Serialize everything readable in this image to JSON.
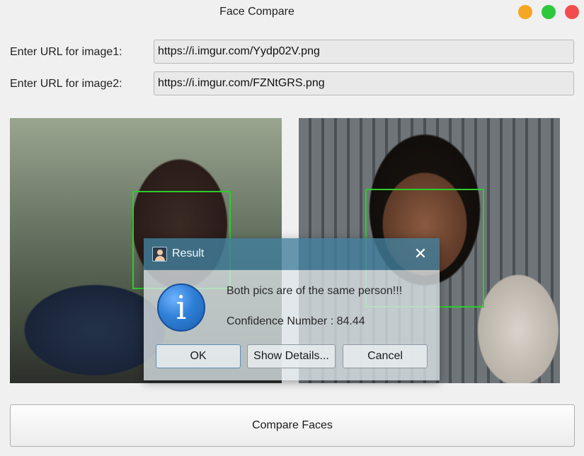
{
  "window": {
    "title": "Face Compare",
    "controls": {
      "minimize_color": "#f5a623",
      "maximize_color": "#2dc83c",
      "close_color": "#f24c4c"
    }
  },
  "form": {
    "image1_label": "Enter URL for image1:",
    "image1_value": "https://i.imgur.com/Yydp02V.png",
    "image2_label": "Enter URL for image2:",
    "image2_value": "https://i.imgur.com/FZNtGRS.png"
  },
  "images": [
    {
      "name": "image1-preview",
      "face_box_color": "#2ecc2e"
    },
    {
      "name": "image2-preview",
      "face_box_color": "#2ecc2e"
    }
  ],
  "compare_button": {
    "label": "Compare Faces"
  },
  "dialog": {
    "title": "Result",
    "close_glyph": "✕",
    "icon": "info-icon",
    "message": "Both pics are of the same person!!!",
    "confidence": "Confidence Number : 84.44",
    "buttons": {
      "ok": "OK",
      "details": "Show Details...",
      "cancel": "Cancel"
    }
  }
}
